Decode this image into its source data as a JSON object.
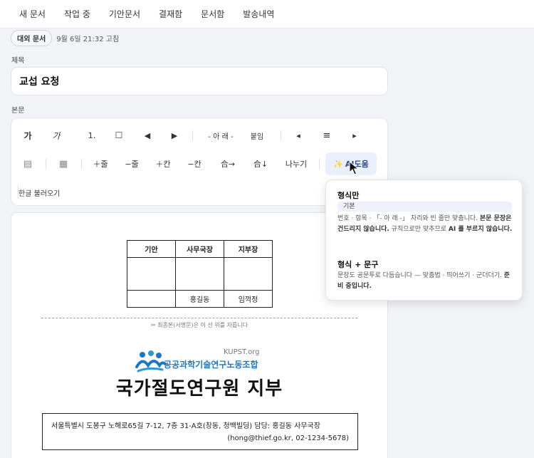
{
  "nav": [
    "새 문서",
    "작업 중",
    "기안문서",
    "결재함",
    "문서함",
    "발송내역"
  ],
  "doc": {
    "badge": "대외 문서",
    "edited": "9월 6일 21:32 고침"
  },
  "title_field": {
    "label": "제목",
    "value": "교섭 요청"
  },
  "body_field": {
    "label": "본문"
  },
  "toolbar": {
    "row1": {
      "bold": "가",
      "italic": "가",
      "numbered": "1.",
      "checkbox": "☐",
      "prev": "◀",
      "next": "▶",
      "below": "- 아 래 -",
      "attach": "붙임",
      "align_left": "◂",
      "align_center": "≡",
      "align_right": "▸"
    },
    "row2": {
      "list": "▤",
      "table": "▦",
      "add_row": "＋줄",
      "del_row": "−줄",
      "add_col": "＋칸",
      "del_col": "−칸",
      "merge_right": "合→",
      "merge_down": "合↓",
      "split": "나누기",
      "ai": "AI도움",
      "ai_sparkle": "✨"
    },
    "import": "한글 불러오기"
  },
  "approval": {
    "headers": [
      "기안",
      "사무국장",
      "지부장"
    ],
    "names": [
      "",
      "홍길동",
      "임꺽정"
    ]
  },
  "cut_notice": "✂ 최종본(서명문)은 이 선 위를 자릅니다",
  "logo": {
    "tag": "KUPST.org",
    "name": "공공과학기술연구노동조합"
  },
  "org_title": "국가절도연구원 지부",
  "address": {
    "line1": "서울특별시 도봉구 노해로65길 7-12, 7층 31-A호(창동, 청백빌딩) 담당: 홍길동 사무국장",
    "line2": "(hong@thief.go.kr, 02-1234-5678)"
  },
  "ai_popup": {
    "opt1_title": "형식만",
    "opt1_chip": "기본",
    "opt1_d1": "번호 · 항목 · 「- 아 래 -」 자리와 빈 줄만 맞춥니다. ",
    "opt1_d2": "본문 문장은 건드리지 않습니다.",
    "opt1_d3": " 규칙으로만 맞추므로 ",
    "opt1_d4": "AI 를 부르지 않습니다.",
    "opt2_title": "형식 + 문구",
    "opt2_d1": "문장도 공문투로 다듬습니다 — 맞춤법 · 띄어쓰기 · 군더더기. ",
    "opt2_d2": "준비 중입니다."
  },
  "colors": {
    "accent": "#1d76c4",
    "ai_bg": "#eaf0fb",
    "background": "#f1f3f6"
  }
}
